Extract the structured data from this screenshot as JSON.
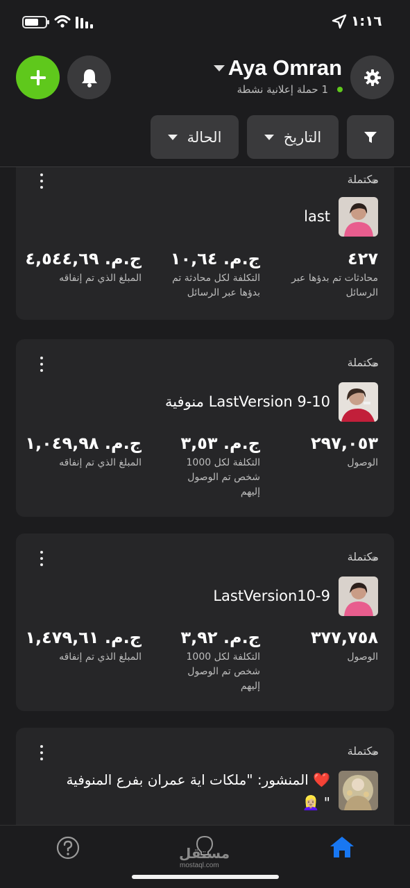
{
  "status_bar": {
    "time": "١:١٦",
    "icons": [
      "battery-icon",
      "wifi-icon",
      "signal-icon",
      "location-arrow-icon"
    ]
  },
  "header": {
    "account_name": "Aya Omran",
    "active_campaigns": "1 حملة إعلانية نشطة",
    "add_icon": "plus-icon",
    "notifications_icon": "bell-icon",
    "settings_icon": "gear-icon"
  },
  "filters": {
    "status_label": "الحالة",
    "date_label": "التاريخ",
    "filter_icon": "funnel-icon"
  },
  "campaigns": [
    {
      "status": "مكتملة",
      "name": "last",
      "metrics": [
        {
          "value": "٤٢٧",
          "label": "محادثات تم بدؤها عبر الرسائل"
        },
        {
          "value": "ج.م. ١٠,٦٤",
          "label": "التكلفة لكل محادثة تم بدؤها عبر الرسائل"
        },
        {
          "value": "ج.م. ٤,٥٤٤,٦٩",
          "label": "المبلغ الذي تم إنفاقه"
        }
      ]
    },
    {
      "status": "مكتملة",
      "name": "منوفية LastVersion 9-10",
      "metrics": [
        {
          "value": "٢٩٧,٠٥٣",
          "label": "الوصول"
        },
        {
          "value": "ج.م. ٣,٥٣",
          "label": "التكلفة لكل 1000 شخص تم الوصول إليهم"
        },
        {
          "value": "ج.م. ١,٠٤٩,٩٨",
          "label": "المبلغ الذي تم إنفاقه"
        }
      ]
    },
    {
      "status": "مكتملة",
      "name": "LastVersion10-9",
      "metrics": [
        {
          "value": "٣٧٧,٧٥٨",
          "label": "الوصول"
        },
        {
          "value": "ج.م. ٣,٩٢",
          "label": "التكلفة لكل 1000 شخص تم الوصول إليهم"
        },
        {
          "value": "ج.م. ١,٤٧٩,٦١",
          "label": "المبلغ الذي تم إنفاقه"
        }
      ]
    },
    {
      "status": "مكتملة",
      "name": "المنشور: \"ملكات اية عمران بفرع المنوفية ❤️ 👱🏼‍♀️\"",
      "name_line1": "المنشور: \"ملكات اية عمران بفرع المنوفية ❤️",
      "name_line2": "\" 👱🏼‍♀️"
    }
  ],
  "bottom_nav": {
    "items": [
      "help-icon",
      "lightbulb-icon",
      "home-icon"
    ],
    "active": "home-icon",
    "accent_color": "#1877f2",
    "watermark": "مستقل",
    "watermark_sub": "mostaql.com"
  },
  "colors": {
    "background": "#1c1c1e",
    "card": "#262628",
    "add_button": "#5fc81c",
    "active_dot": "#5fc81c"
  }
}
